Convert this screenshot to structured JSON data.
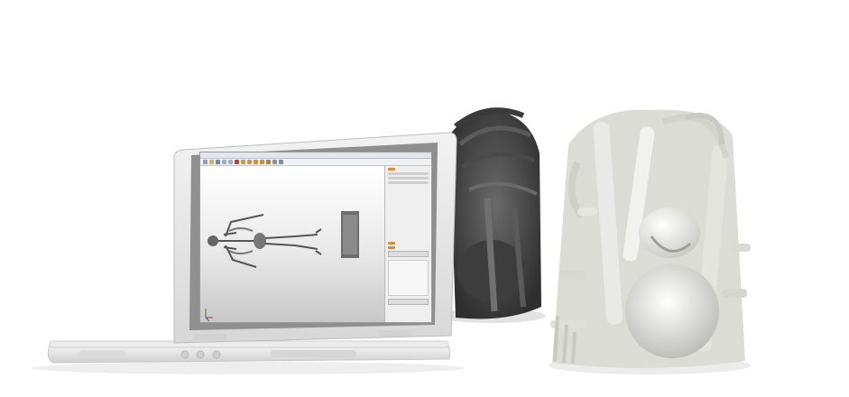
{
  "scene": {
    "description_free": true,
    "colors": {
      "background": "#ffffff",
      "laptop": "#e4e4e4",
      "print_dark": "#4a4a4a",
      "print_light": "#d6d6d2"
    }
  },
  "screen_app": {
    "toolbar_icons": [
      "file-icon",
      "open-icon",
      "save-icon",
      "undo-icon",
      "redo-icon",
      "cut-icon",
      "copy-icon",
      "paste-icon",
      "select-icon",
      "move-icon",
      "rotate-icon",
      "scale-icon",
      "view-icon"
    ],
    "accent": "#e08a2a"
  }
}
